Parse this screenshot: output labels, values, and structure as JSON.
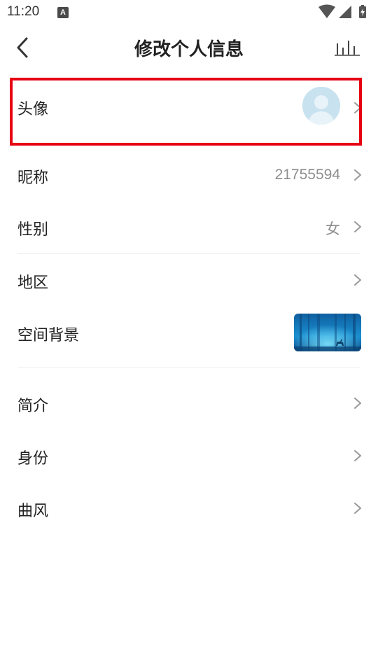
{
  "status_bar": {
    "time": "11:20",
    "notification_icon_letter": "A",
    "icons": [
      "wifi-icon",
      "signal-icon",
      "battery-charging-icon"
    ]
  },
  "nav": {
    "title": "修改个人信息",
    "back_icon": "chevron-left-icon",
    "right_icon": "bar-chart-icon"
  },
  "rows": {
    "avatar": {
      "label": "头像",
      "highlighted": true
    },
    "nickname": {
      "label": "昵称",
      "value": "21755594"
    },
    "gender": {
      "label": "性别",
      "value": "女"
    },
    "region": {
      "label": "地区"
    },
    "space_background": {
      "label": "空间背景"
    },
    "intro": {
      "label": "简介"
    },
    "identity": {
      "label": "身份"
    },
    "music_style": {
      "label": "曲风"
    }
  },
  "colors": {
    "highlight_border": "#e60012",
    "text_primary": "#222222",
    "text_secondary": "#8e8e8e",
    "divider": "#ededed",
    "chevron": "#9a9a9a"
  }
}
